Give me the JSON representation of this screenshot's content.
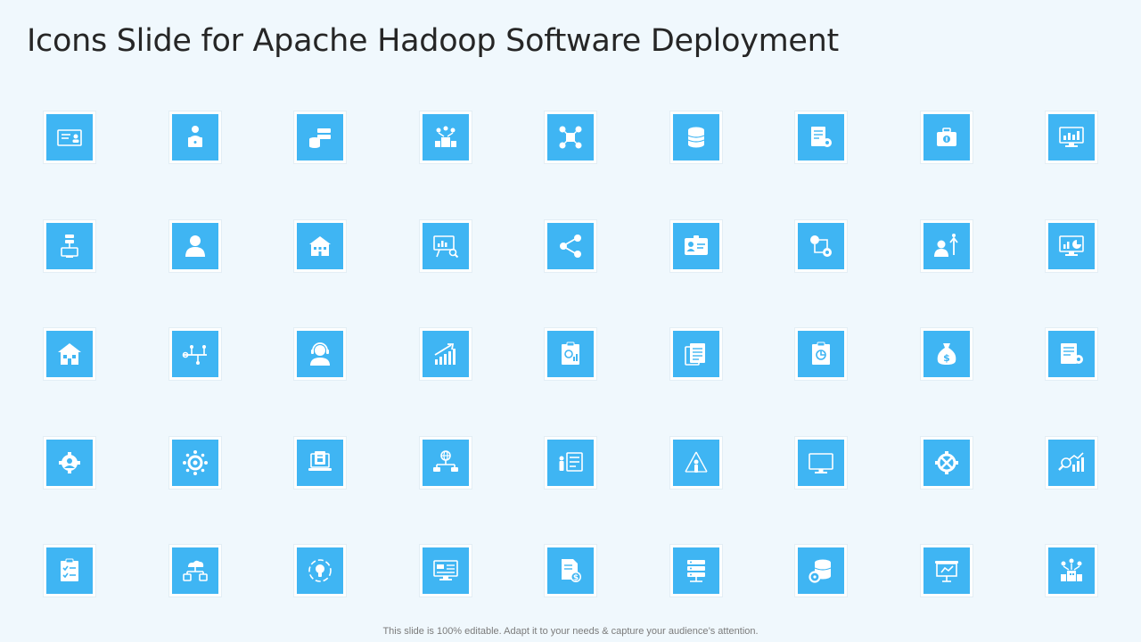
{
  "slide": {
    "title": "Icons Slide for Apache Hadoop Software Deployment",
    "footer": "This slide is 100% editable. Adapt it to your needs & capture your audience’s attention."
  },
  "colors": {
    "background": "#f0f8fd",
    "tile_fill": "#3fb5f3",
    "tile_border": "#fdfefe",
    "title_text": "#262626",
    "footer_text": "#7b7b7b"
  },
  "icons": [
    "id-card-icon",
    "presenter-laptop-icon",
    "database-server-icon",
    "network-buildings-icon",
    "connected-checklist-icon",
    "database-icon",
    "document-settings-icon",
    "money-briefcase-icon",
    "dashboard-monitor-icon",
    "server-computer-icon",
    "user-icon",
    "office-building-icon",
    "presentation-analysis-icon",
    "share-network-icon",
    "id-badge-icon",
    "process-flow-icon",
    "user-growth-icon",
    "analytics-monitor-icon",
    "house-building-icon",
    "timeline-nodes-icon",
    "customer-support-icon",
    "growth-chart-icon",
    "report-clipboard-icon",
    "documents-stack-icon",
    "analysis-clipboard-icon",
    "money-bag-icon",
    "document-gear-icon",
    "team-gear-icon",
    "gear-network-icon",
    "laptop-report-icon",
    "global-network-icon",
    "presenter-board-icon",
    "user-hierarchy-icon",
    "desktop-monitor-icon",
    "tools-gear-icon",
    "data-analytics-icon",
    "checklist-clipboard-icon",
    "cloud-sharing-icon",
    "idea-cycle-icon",
    "computer-dashboard-icon",
    "dollar-document-icon",
    "server-rack-icon",
    "database-gear-icon",
    "presentation-screen-icon",
    "city-network-icon"
  ]
}
